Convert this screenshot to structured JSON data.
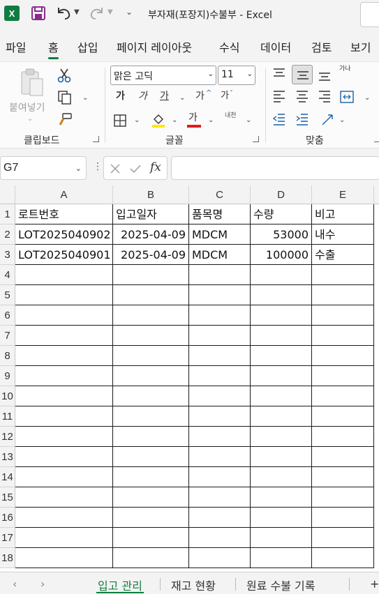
{
  "app": {
    "title": "부자재(포장지)수불부  -  Excel"
  },
  "quick_access": {
    "logo_letter": "X"
  },
  "ribbon_tabs": [
    "파일",
    "홈",
    "삽입",
    "페이지 레이아웃",
    "수식",
    "데이터",
    "검토",
    "보기"
  ],
  "ribbon": {
    "clipboard": {
      "paste_label": "붙여넣기",
      "group_label": "클립보드"
    },
    "font": {
      "font_name": "맑은 고딕",
      "font_size": "11",
      "group_label": "글꼴",
      "bold": "가",
      "italic": "가",
      "underline": "가",
      "grow": "가",
      "shrink": "가",
      "font_color_glyph": "가",
      "phonetic_glyph": "내천"
    },
    "alignment": {
      "group_label": "맞춤",
      "wrap_glyph": "가나"
    }
  },
  "formula_bar": {
    "name_box": "G7",
    "fx_label": "fx",
    "formula": ""
  },
  "grid": {
    "columns": [
      "A",
      "B",
      "C",
      "D",
      "E"
    ],
    "row_numbers": [
      "1",
      "2",
      "3",
      "4",
      "5",
      "6",
      "7",
      "8",
      "9",
      "10",
      "11",
      "12",
      "13",
      "14",
      "15",
      "16",
      "17",
      "18"
    ],
    "headers": [
      "로트번호",
      "입고일자",
      "품목명",
      "수량",
      "비고"
    ],
    "rows": [
      [
        "LOT2025040902",
        "2025-04-09",
        "MDCM",
        "53000",
        "내수"
      ],
      [
        "LOT2025040901",
        "2025-04-09",
        "MDCM",
        "100000",
        "수출"
      ]
    ]
  },
  "sheets": [
    "입고 관리",
    "재고 현황",
    "원료 수불 기록"
  ],
  "accent_color": "#107c41"
}
